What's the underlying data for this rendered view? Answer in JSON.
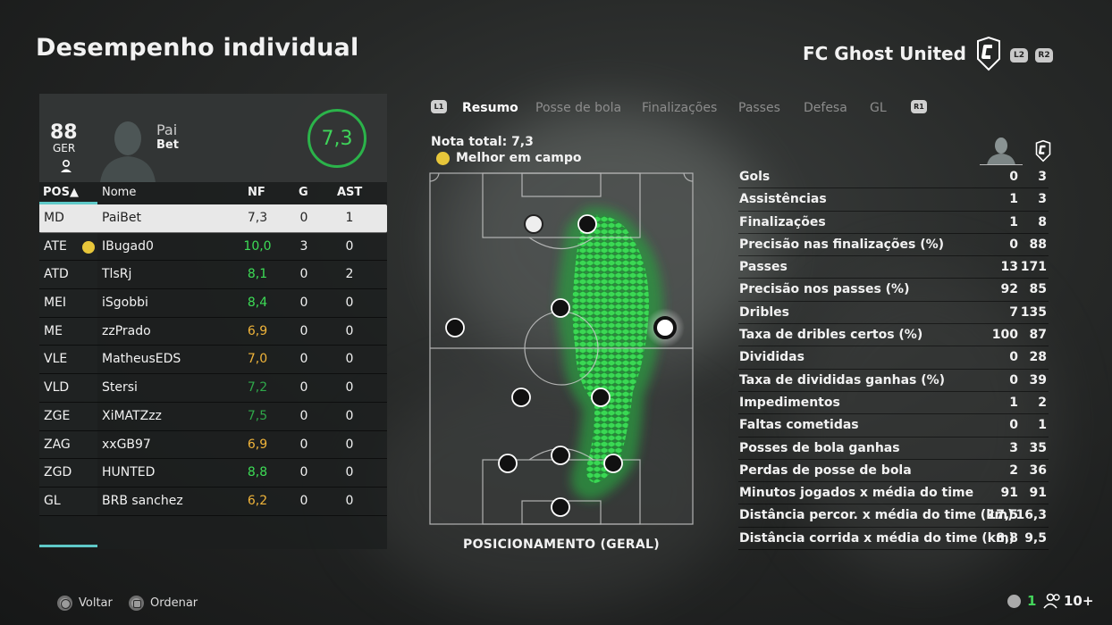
{
  "header": {
    "title": "Desempenho individual",
    "team_name": "FC Ghost United",
    "left_trigger": "L2",
    "right_trigger": "R2"
  },
  "player_card": {
    "overall": "88",
    "nationality": "GER",
    "first_name": "Pai",
    "last_name": "Bet",
    "match_rating": "7,3"
  },
  "roster_table": {
    "headers": {
      "pos": "POS▲",
      "name": "Nome",
      "nf": "NF",
      "g": "G",
      "ast": "AST"
    },
    "rows": [
      {
        "pos": "MD",
        "name": "PaiBet",
        "nf": "7,3",
        "g": "0",
        "ast": "1",
        "selected": true,
        "nf_color": "#2a2a2a"
      },
      {
        "pos": "ATE",
        "name": "IBugad0",
        "nf": "10,0",
        "g": "3",
        "ast": "0",
        "mvp": true,
        "nf_color": "#3ddc56"
      },
      {
        "pos": "ATD",
        "name": "TlsRj",
        "nf": "8,1",
        "g": "0",
        "ast": "2",
        "nf_color": "#3ddc56"
      },
      {
        "pos": "MEI",
        "name": "iSgobbi",
        "nf": "8,4",
        "g": "0",
        "ast": "0",
        "nf_color": "#3ddc56"
      },
      {
        "pos": "ME",
        "name": "zzPrado",
        "nf": "6,9",
        "g": "0",
        "ast": "0",
        "nf_color": "#f0b43a"
      },
      {
        "pos": "VLE",
        "name": "MatheusEDS",
        "nf": "7,0",
        "g": "0",
        "ast": "0",
        "nf_color": "#f0b43a"
      },
      {
        "pos": "VLD",
        "name": "Stersi",
        "nf": "7,2",
        "g": "0",
        "ast": "0",
        "nf_color": "#2fa84a"
      },
      {
        "pos": "ZGE",
        "name": "XiMATZzz",
        "nf": "7,5",
        "g": "0",
        "ast": "0",
        "nf_color": "#2fa84a"
      },
      {
        "pos": "ZAG",
        "name": "xxGB97",
        "nf": "6,9",
        "g": "0",
        "ast": "0",
        "nf_color": "#f0b43a"
      },
      {
        "pos": "ZGD",
        "name": "HUNTED",
        "nf": "8,8",
        "g": "0",
        "ast": "0",
        "nf_color": "#3ddc56"
      },
      {
        "pos": "GL",
        "name": "BRB sanchez",
        "nf": "6,2",
        "g": "0",
        "ast": "0",
        "nf_color": "#f0b43a"
      }
    ]
  },
  "tabs": {
    "left_button": "L1",
    "right_button": "R1",
    "items": [
      {
        "label": "Resumo",
        "active": true
      },
      {
        "label": "Posse de bola",
        "active": false
      },
      {
        "label": "Finalizações",
        "active": false
      },
      {
        "label": "Passes",
        "active": false
      },
      {
        "label": "Defesa",
        "active": false
      },
      {
        "label": "GL",
        "active": false
      }
    ]
  },
  "summary": {
    "total_rating": "Nota total: 7,3",
    "best_player": "Melhor em campo",
    "pitch_caption": "POSICIONAMENTO (GERAL)"
  },
  "stats": [
    {
      "label": "Gols",
      "player": "0",
      "team": "3"
    },
    {
      "label": "Assistências",
      "player": "1",
      "team": "3"
    },
    {
      "label": "Finalizações",
      "player": "1",
      "team": "8"
    },
    {
      "label": "Precisão nas finalizações (%)",
      "player": "0",
      "team": "88"
    },
    {
      "label": "Passes",
      "player": "13",
      "team": "171"
    },
    {
      "label": "Precisão nos passes (%)",
      "player": "92",
      "team": "85"
    },
    {
      "label": "Dribles",
      "player": "7",
      "team": "135"
    },
    {
      "label": "Taxa de dribles certos (%)",
      "player": "100",
      "team": "87"
    },
    {
      "label": "Divididas",
      "player": "0",
      "team": "28"
    },
    {
      "label": "Taxa de divididas ganhas (%)",
      "player": "0",
      "team": "39"
    },
    {
      "label": "Impedimentos",
      "player": "1",
      "team": "2"
    },
    {
      "label": "Faltas cometidas",
      "player": "0",
      "team": "1"
    },
    {
      "label": "Posses de bola ganhas",
      "player": "3",
      "team": "35"
    },
    {
      "label": "Perdas de posse de bola",
      "player": "2",
      "team": "36"
    },
    {
      "label": "Minutos jogados x média do time",
      "player": "91",
      "team": "91"
    },
    {
      "label": "Distância percor. x média do time (km)",
      "player": "17,5",
      "team": "16,3"
    },
    {
      "label": "Distância corrida x média do time (km)",
      "player": "8,8",
      "team": "9,5"
    }
  ],
  "footer": {
    "back_label": "Voltar",
    "sort_label": "Ordenar",
    "network_value": "1",
    "players_value": "10+"
  },
  "colors": {
    "accent_teal": "#5fc9c8",
    "rating_green": "#3ddc56",
    "rating_orange": "#f0b43a",
    "heat_green": "#3bdc55"
  }
}
